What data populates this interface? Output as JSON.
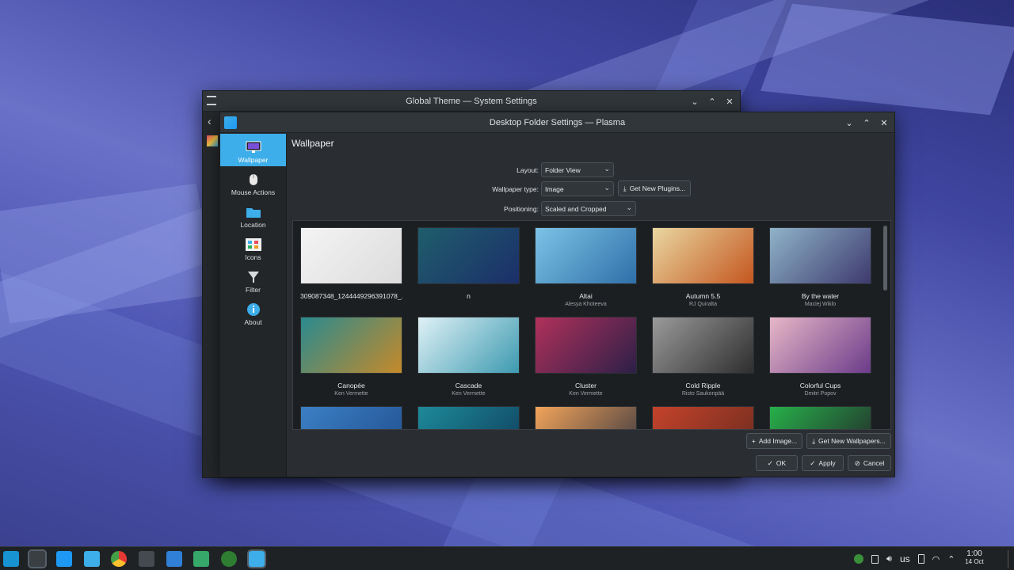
{
  "outer_window": {
    "title": "Global Theme — System Settings"
  },
  "dialog": {
    "title": "Desktop Folder Settings — Plasma",
    "heading": "Wallpaper",
    "sidebar": [
      {
        "label": "Wallpaper",
        "icon": "monitor-icon",
        "active": true
      },
      {
        "label": "Mouse Actions",
        "icon": "mouse-icon",
        "active": false
      },
      {
        "label": "Location",
        "icon": "folder-icon",
        "active": false
      },
      {
        "label": "Icons",
        "icon": "icons-grid-icon",
        "active": false
      },
      {
        "label": "Filter",
        "icon": "filter-icon",
        "active": false
      },
      {
        "label": "About",
        "icon": "info-icon",
        "active": false
      }
    ],
    "form": {
      "layout_label": "Layout:",
      "layout_value": "Folder View",
      "wallpaper_type_label": "Wallpaper type:",
      "wallpaper_type_value": "Image",
      "get_plugins_label": "Get New Plugins...",
      "positioning_label": "Positioning:",
      "positioning_value": "Scaled and Cropped"
    },
    "wallpapers": [
      {
        "title": "309087348_1244449296391078_...",
        "author": "",
        "colors": [
          "#f4f4f4",
          "#dcdcdc"
        ]
      },
      {
        "title": "n",
        "author": "",
        "colors": [
          "#1f5d6b",
          "#1b2f6a"
        ]
      },
      {
        "title": "Altai",
        "author": "Alesya Khoteeva",
        "colors": [
          "#7cc3e6",
          "#2f6fa8"
        ]
      },
      {
        "title": "Autumn 5.5",
        "author": "RJ Quiralta",
        "colors": [
          "#e9d6a0",
          "#c4561f"
        ]
      },
      {
        "title": "By the water",
        "author": "Maciej Wiklo",
        "colors": [
          "#8fb3c9",
          "#3d3a6d"
        ]
      },
      {
        "title": "Canopée",
        "author": "Ken Vermette",
        "colors": [
          "#2a8a8f",
          "#c58a2a"
        ]
      },
      {
        "title": "Cascade",
        "author": "Ken Vermette",
        "colors": [
          "#dff1f6",
          "#3d9ab0"
        ]
      },
      {
        "title": "Cluster",
        "author": "Ken Vermette",
        "colors": [
          "#b0315a",
          "#2c1f48"
        ]
      },
      {
        "title": "Cold Ripple",
        "author": "Risto Saukonpää",
        "colors": [
          "#9a9a9a",
          "#2e2e2e"
        ]
      },
      {
        "title": "Colorful Cups",
        "author": "Dmitri Popov",
        "colors": [
          "#e7b7c7",
          "#6b3b8a"
        ]
      },
      {
        "title": "",
        "author": "",
        "colors": [
          "#3c7fc4",
          "#1f4f8f"
        ]
      },
      {
        "title": "",
        "author": "",
        "colors": [
          "#1d8a9a",
          "#0f3d5c"
        ]
      },
      {
        "title": "",
        "author": "",
        "colors": [
          "#f2a45a",
          "#37353f"
        ]
      },
      {
        "title": "",
        "author": "",
        "colors": [
          "#c4432b",
          "#6a2a1f"
        ]
      },
      {
        "title": "",
        "author": "",
        "colors": [
          "#27b04a",
          "#23262a"
        ]
      }
    ],
    "buttons": {
      "add_image": "Add Image...",
      "get_wallpapers": "Get New Wallpapers...",
      "ok": "OK",
      "apply": "Apply",
      "cancel": "Cancel"
    }
  },
  "taskbar": {
    "apps": [
      "launcher-icon",
      "system-settings-icon",
      "store-icon",
      "files-icon",
      "chrome-icon",
      "terminal-icon",
      "vscode-icon",
      "image-viewer-icon",
      "steam-icon",
      "plasma-settings-icon"
    ],
    "keyboard_layout": "us",
    "time": "1:00",
    "date": "14 Oct"
  },
  "colors": {
    "accent": "#3daee9",
    "panel": "#2a2e32",
    "taskbar": "#1f2225"
  }
}
